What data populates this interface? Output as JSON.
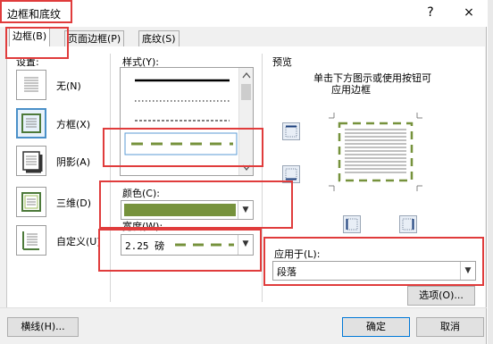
{
  "window": {
    "title": "边框和底纹",
    "help_label": "?",
    "close_label": "×"
  },
  "tabs": [
    {
      "label": "边框(B)"
    },
    {
      "label": "页面边框(P)"
    },
    {
      "label": "底纹(S)"
    }
  ],
  "settings": {
    "heading": "设置:",
    "items": [
      {
        "label": "无(N)"
      },
      {
        "label": "方框(X)"
      },
      {
        "label": "阴影(A)"
      },
      {
        "label": "三维(D)"
      },
      {
        "label": "自定义(U)"
      }
    ]
  },
  "style": {
    "heading": "样式(Y):"
  },
  "color": {
    "heading": "颜色(C):",
    "value_color": "#76923c"
  },
  "width": {
    "heading": "宽度(W):",
    "value": "2.25 磅"
  },
  "preview": {
    "heading": "预览",
    "hint_line1": "单击下方图示或使用按钮可",
    "hint_line2": "应用边框"
  },
  "apply_to": {
    "heading": "应用于(L):",
    "value": "段落"
  },
  "buttons": {
    "options": "选项(O)...",
    "horizontal_line": "横线(H)...",
    "ok": "确定",
    "cancel": "取消"
  },
  "colors": {
    "highlight": "#e03c3c",
    "border_sample": "#76923c",
    "accent": "#0078d7"
  }
}
